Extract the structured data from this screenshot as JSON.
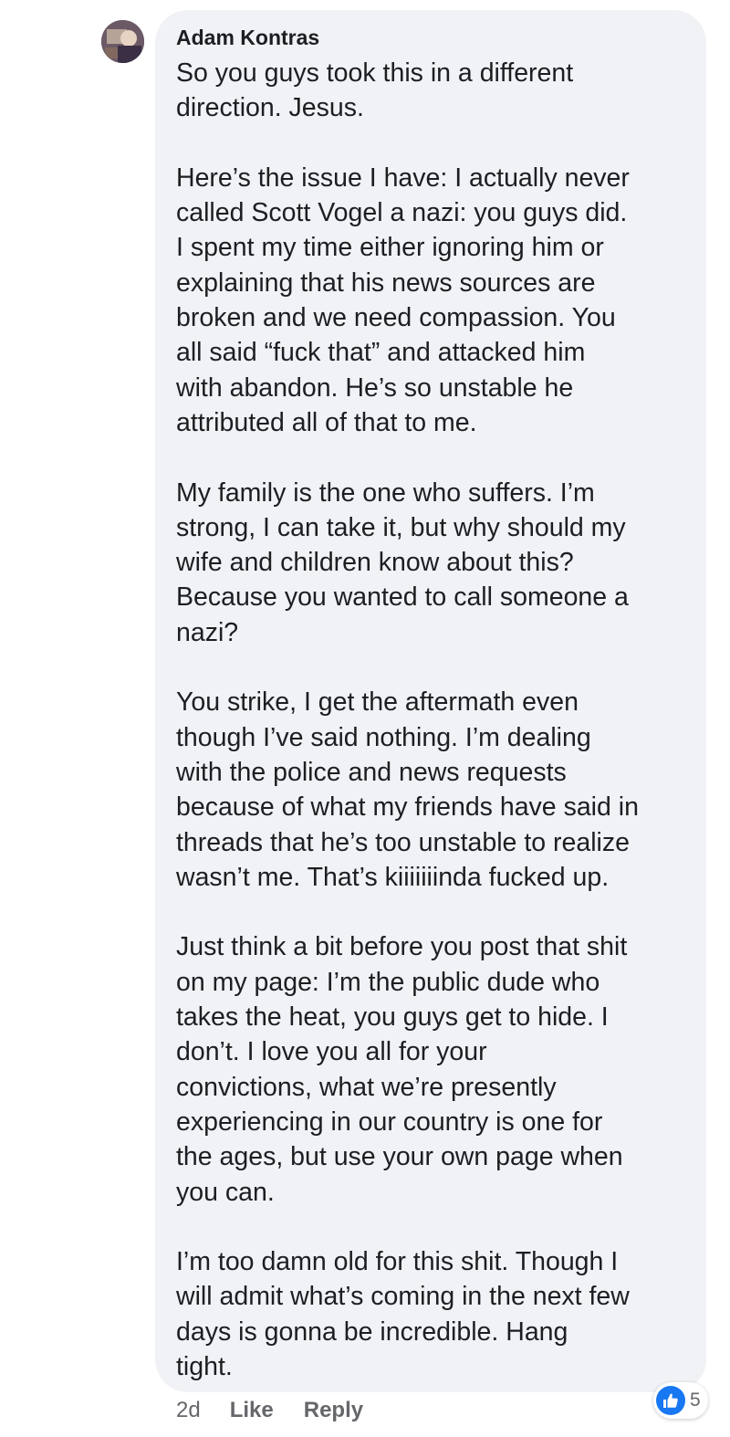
{
  "comment": {
    "author": "Adam Kontras",
    "message": "So you guys took this in a different\ndirection.  Jesus.\n\nHere’s the issue I have:  I actually never\ncalled Scott Vogel a nazi: you guys did.\nI spent my time either ignoring him or\nexplaining that his news sources are\nbroken and we need compassion.  You\nall said “fuck that” and attacked him\nwith abandon.  He’s so unstable he\nattributed all of that to me.\n\nMy family is the one who suffers.  I’m\nstrong, I can take it, but why should my\nwife and children know about this?\nBecause you wanted to call someone a\nnazi?\n\nYou strike, I get the aftermath even\nthough I’ve said nothing.  I’m dealing\nwith the police and news requests\nbecause of what my friends have said in\nthreads that he’s too unstable to realize\nwasn’t me.  That’s kiiiiiiinda fucked up.\n\nJust think a bit before you post that shit\non my page: I’m the public dude who\ntakes the heat, you guys get to hide.  I\ndon’t.  I love you all for your\nconvictions, what we’re presently\nexperiencing in our country is one for\nthe ages, but use your own page when\nyou can.\n\nI’m too damn old for this shit.   Though I\nwill admit what’s coming in the next few\ndays is gonna be incredible.  Hang\ntight.",
    "timestamp": "2d",
    "like_label": "Like",
    "reply_label": "Reply",
    "reaction_count": "5",
    "reaction_icon": "thumbs-up-icon",
    "reaction_color": "#1877f2",
    "bubble_color": "#f0f2f5",
    "meta_text_color": "#65676b"
  }
}
